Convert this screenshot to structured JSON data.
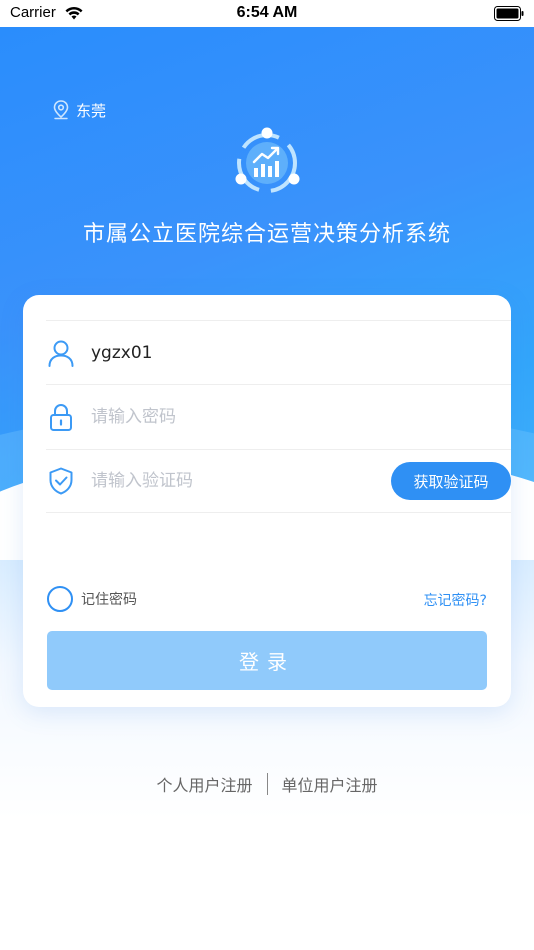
{
  "status_bar": {
    "carrier": "Carrier",
    "time": "6:54 AM"
  },
  "header": {
    "location": "东莞",
    "location_icon": "location-pin-icon",
    "logo_icon": "analytics-chart-logo",
    "title": "市属公立医院综合运营决策分析系统"
  },
  "form": {
    "username": {
      "value": "ygzx01",
      "icon": "user-icon"
    },
    "password": {
      "placeholder": "请输入密码",
      "icon": "lock-icon"
    },
    "code": {
      "placeholder": "请输入验证码",
      "icon": "shield-check-icon",
      "button": "获取验证码"
    },
    "remember_label": "记住密码",
    "forgot_label": "忘记密码?",
    "login_label": "登录"
  },
  "register": {
    "personal": "个人用户注册",
    "organization": "单位用户注册"
  },
  "colors": {
    "primary": "#2f90f4",
    "login_button_disabled": "#90cafb",
    "hero_gradient_start": "#2a8dfc",
    "hero_gradient_end": "#49b7fb"
  }
}
